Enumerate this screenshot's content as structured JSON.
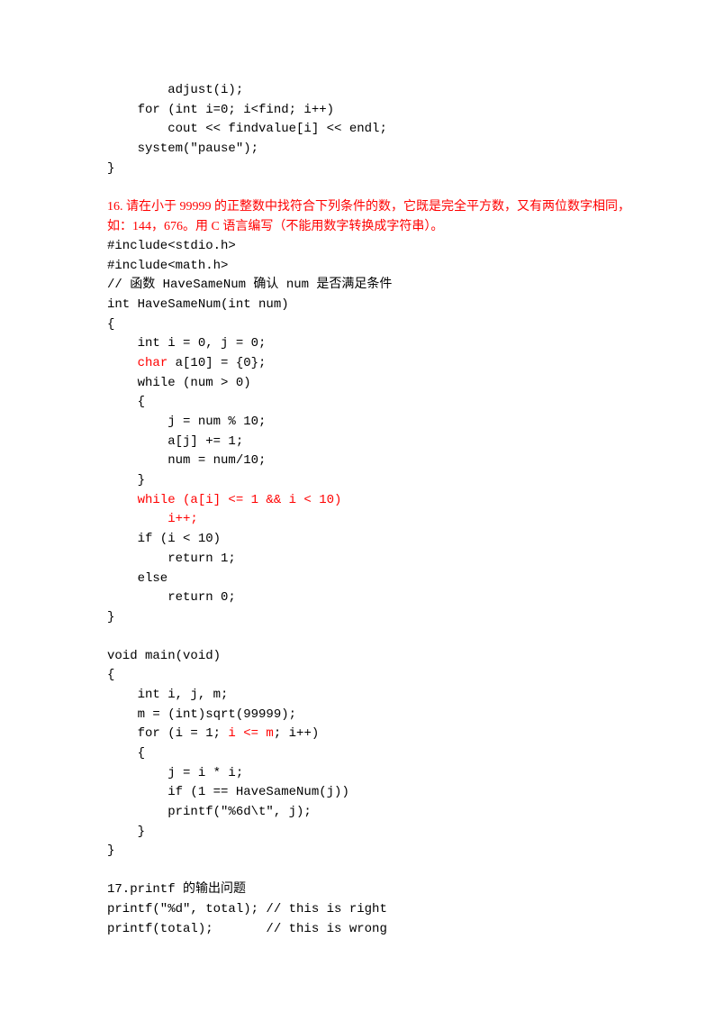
{
  "lines": [
    {
      "text": "        adjust(i);",
      "color": "black"
    },
    {
      "text": "    for (int i=0; i<find; i++)",
      "color": "black"
    },
    {
      "text": "        cout << findvalue[i] << endl;",
      "color": "black"
    },
    {
      "text": "    system(\"pause\");",
      "color": "black"
    },
    {
      "text": "}",
      "color": "black"
    },
    {
      "text": "",
      "color": "blank"
    },
    {
      "text": "16. 请在小于 99999 的正整数中找符合下列条件的数，它既是完全平方数，又有两位数字相同，如：144，676。用 C 语言编写（不能用数字转换成字符串）。",
      "color": "red",
      "wrap": true
    },
    {
      "text": "#include<stdio.h>",
      "color": "black"
    },
    {
      "text": "#include<math.h>",
      "color": "black"
    },
    {
      "text": "// 函数 HaveSameNum 确认 num 是否满足条件",
      "color": "black"
    },
    {
      "text": "int HaveSameNum(int num)",
      "color": "black"
    },
    {
      "text": "{",
      "color": "black"
    },
    {
      "text": "    int i = 0, j = 0;",
      "color": "black"
    },
    {
      "segments": [
        {
          "text": "    ",
          "color": "black"
        },
        {
          "text": "char",
          "color": "red"
        },
        {
          "text": " a[10] = {0};",
          "color": "black"
        }
      ]
    },
    {
      "text": "    while (num > 0)",
      "color": "black"
    },
    {
      "text": "    {",
      "color": "black"
    },
    {
      "text": "        j = num % 10;",
      "color": "black"
    },
    {
      "text": "        a[j] += 1;",
      "color": "black"
    },
    {
      "text": "        num = num/10;",
      "color": "black"
    },
    {
      "text": "    }",
      "color": "black"
    },
    {
      "text": "    while (a[i] <= 1 && i < 10)",
      "color": "red"
    },
    {
      "text": "        i++;",
      "color": "red"
    },
    {
      "text": "    if (i < 10)",
      "color": "black"
    },
    {
      "text": "        return 1;",
      "color": "black"
    },
    {
      "text": "    else",
      "color": "black"
    },
    {
      "text": "        return 0;",
      "color": "black"
    },
    {
      "text": "}",
      "color": "black"
    },
    {
      "text": "",
      "color": "blank"
    },
    {
      "text": "void main(void)",
      "color": "black"
    },
    {
      "text": "{",
      "color": "black"
    },
    {
      "text": "    int i, j, m;",
      "color": "black"
    },
    {
      "text": "    m = (int)sqrt(99999);",
      "color": "black"
    },
    {
      "segments": [
        {
          "text": "    for (i = 1; ",
          "color": "black"
        },
        {
          "text": "i <= m",
          "color": "red"
        },
        {
          "text": "; i++)",
          "color": "black"
        }
      ]
    },
    {
      "text": "    {",
      "color": "black"
    },
    {
      "text": "        j = i * i;",
      "color": "black"
    },
    {
      "text": "        if (1 == HaveSameNum(j))",
      "color": "black"
    },
    {
      "text": "        printf(\"%6d\\t\", j);",
      "color": "black"
    },
    {
      "text": "    }",
      "color": "black"
    },
    {
      "text": "}",
      "color": "black"
    },
    {
      "text": "",
      "color": "blank"
    },
    {
      "text": "17.printf 的输出问题",
      "color": "black"
    },
    {
      "text": "printf(\"%d\", total); // this is right",
      "color": "black"
    },
    {
      "text": "printf(total);       // this is wrong",
      "color": "black"
    }
  ]
}
